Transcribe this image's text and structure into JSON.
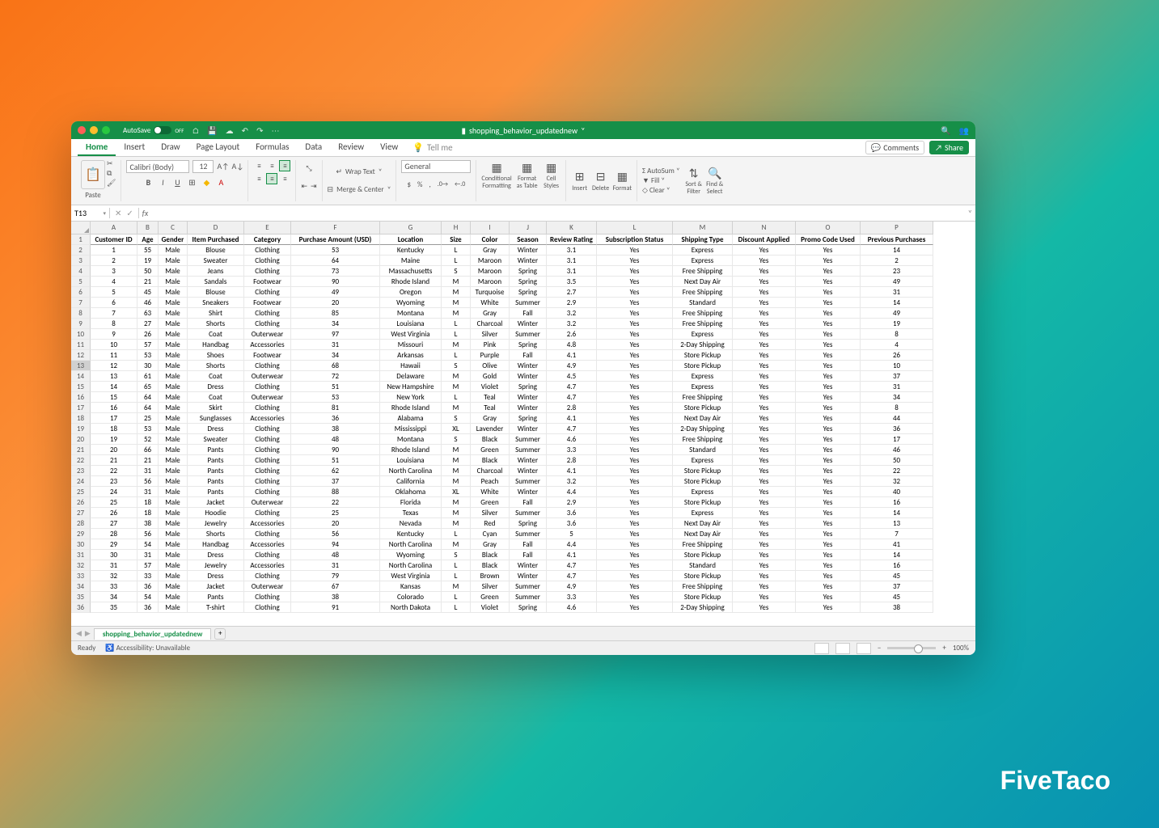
{
  "titlebar": {
    "autosave_label": "AutoSave",
    "autosave_state": "OFF",
    "filename": "shopping_behavior_updatednew"
  },
  "tabs": {
    "items": [
      "Home",
      "Insert",
      "Draw",
      "Page Layout",
      "Formulas",
      "Data",
      "Review",
      "View"
    ],
    "active": 0,
    "tellme": "Tell me",
    "comments": "Comments",
    "share": "Share"
  },
  "ribbon": {
    "paste": "Paste",
    "font_name": "Calibri (Body)",
    "font_size": "12",
    "wrap_text": "Wrap Text",
    "merge_center": "Merge & Center",
    "number_format": "General",
    "conditional": "Conditional",
    "conditional2": "Formatting",
    "format_as": "Format",
    "format_as2": "as Table",
    "cell_styles": "Cell",
    "cell_styles2": "Styles",
    "insert": "Insert",
    "delete": "Delete",
    "format": "Format",
    "autosum": "AutoSum",
    "fill": "Fill",
    "clear": "Clear",
    "sort": "Sort &",
    "sort2": "Filter",
    "find": "Find &",
    "find2": "Select"
  },
  "namebox": "T13",
  "columns": [
    "A",
    "B",
    "C",
    "D",
    "E",
    "F",
    "G",
    "H",
    "I",
    "J",
    "K",
    "L",
    "M",
    "N",
    "O",
    "P"
  ],
  "selected_row": 13,
  "headers": [
    "Customer ID",
    "Age",
    "Gender",
    "Item Purchased",
    "Category",
    "Purchase Amount (USD)",
    "Location",
    "Size",
    "Color",
    "Season",
    "Review Rating",
    "Subscription Status",
    "Shipping Type",
    "Discount Applied",
    "Promo Code Used",
    "Previous Purchases"
  ],
  "rows": [
    [
      "1",
      "55",
      "Male",
      "Blouse",
      "Clothing",
      "53",
      "Kentucky",
      "L",
      "Gray",
      "Winter",
      "3.1",
      "Yes",
      "Express",
      "Yes",
      "Yes",
      "14"
    ],
    [
      "2",
      "19",
      "Male",
      "Sweater",
      "Clothing",
      "64",
      "Maine",
      "L",
      "Maroon",
      "Winter",
      "3.1",
      "Yes",
      "Express",
      "Yes",
      "Yes",
      "2"
    ],
    [
      "3",
      "50",
      "Male",
      "Jeans",
      "Clothing",
      "73",
      "Massachusetts",
      "S",
      "Maroon",
      "Spring",
      "3.1",
      "Yes",
      "Free Shipping",
      "Yes",
      "Yes",
      "23"
    ],
    [
      "4",
      "21",
      "Male",
      "Sandals",
      "Footwear",
      "90",
      "Rhode Island",
      "M",
      "Maroon",
      "Spring",
      "3.5",
      "Yes",
      "Next Day Air",
      "Yes",
      "Yes",
      "49"
    ],
    [
      "5",
      "45",
      "Male",
      "Blouse",
      "Clothing",
      "49",
      "Oregon",
      "M",
      "Turquoise",
      "Spring",
      "2.7",
      "Yes",
      "Free Shipping",
      "Yes",
      "Yes",
      "31"
    ],
    [
      "6",
      "46",
      "Male",
      "Sneakers",
      "Footwear",
      "20",
      "Wyoming",
      "M",
      "White",
      "Summer",
      "2.9",
      "Yes",
      "Standard",
      "Yes",
      "Yes",
      "14"
    ],
    [
      "7",
      "63",
      "Male",
      "Shirt",
      "Clothing",
      "85",
      "Montana",
      "M",
      "Gray",
      "Fall",
      "3.2",
      "Yes",
      "Free Shipping",
      "Yes",
      "Yes",
      "49"
    ],
    [
      "8",
      "27",
      "Male",
      "Shorts",
      "Clothing",
      "34",
      "Louisiana",
      "L",
      "Charcoal",
      "Winter",
      "3.2",
      "Yes",
      "Free Shipping",
      "Yes",
      "Yes",
      "19"
    ],
    [
      "9",
      "26",
      "Male",
      "Coat",
      "Outerwear",
      "97",
      "West Virginia",
      "L",
      "Silver",
      "Summer",
      "2.6",
      "Yes",
      "Express",
      "Yes",
      "Yes",
      "8"
    ],
    [
      "10",
      "57",
      "Male",
      "Handbag",
      "Accessories",
      "31",
      "Missouri",
      "M",
      "Pink",
      "Spring",
      "4.8",
      "Yes",
      "2-Day Shipping",
      "Yes",
      "Yes",
      "4"
    ],
    [
      "11",
      "53",
      "Male",
      "Shoes",
      "Footwear",
      "34",
      "Arkansas",
      "L",
      "Purple",
      "Fall",
      "4.1",
      "Yes",
      "Store Pickup",
      "Yes",
      "Yes",
      "26"
    ],
    [
      "12",
      "30",
      "Male",
      "Shorts",
      "Clothing",
      "68",
      "Hawaii",
      "S",
      "Olive",
      "Winter",
      "4.9",
      "Yes",
      "Store Pickup",
      "Yes",
      "Yes",
      "10"
    ],
    [
      "13",
      "61",
      "Male",
      "Coat",
      "Outerwear",
      "72",
      "Delaware",
      "M",
      "Gold",
      "Winter",
      "4.5",
      "Yes",
      "Express",
      "Yes",
      "Yes",
      "37"
    ],
    [
      "14",
      "65",
      "Male",
      "Dress",
      "Clothing",
      "51",
      "New Hampshire",
      "M",
      "Violet",
      "Spring",
      "4.7",
      "Yes",
      "Express",
      "Yes",
      "Yes",
      "31"
    ],
    [
      "15",
      "64",
      "Male",
      "Coat",
      "Outerwear",
      "53",
      "New York",
      "L",
      "Teal",
      "Winter",
      "4.7",
      "Yes",
      "Free Shipping",
      "Yes",
      "Yes",
      "34"
    ],
    [
      "16",
      "64",
      "Male",
      "Skirt",
      "Clothing",
      "81",
      "Rhode Island",
      "M",
      "Teal",
      "Winter",
      "2.8",
      "Yes",
      "Store Pickup",
      "Yes",
      "Yes",
      "8"
    ],
    [
      "17",
      "25",
      "Male",
      "Sunglasses",
      "Accessories",
      "36",
      "Alabama",
      "S",
      "Gray",
      "Spring",
      "4.1",
      "Yes",
      "Next Day Air",
      "Yes",
      "Yes",
      "44"
    ],
    [
      "18",
      "53",
      "Male",
      "Dress",
      "Clothing",
      "38",
      "Mississippi",
      "XL",
      "Lavender",
      "Winter",
      "4.7",
      "Yes",
      "2-Day Shipping",
      "Yes",
      "Yes",
      "36"
    ],
    [
      "19",
      "52",
      "Male",
      "Sweater",
      "Clothing",
      "48",
      "Montana",
      "S",
      "Black",
      "Summer",
      "4.6",
      "Yes",
      "Free Shipping",
      "Yes",
      "Yes",
      "17"
    ],
    [
      "20",
      "66",
      "Male",
      "Pants",
      "Clothing",
      "90",
      "Rhode Island",
      "M",
      "Green",
      "Summer",
      "3.3",
      "Yes",
      "Standard",
      "Yes",
      "Yes",
      "46"
    ],
    [
      "21",
      "21",
      "Male",
      "Pants",
      "Clothing",
      "51",
      "Louisiana",
      "M",
      "Black",
      "Winter",
      "2.8",
      "Yes",
      "Express",
      "Yes",
      "Yes",
      "50"
    ],
    [
      "22",
      "31",
      "Male",
      "Pants",
      "Clothing",
      "62",
      "North Carolina",
      "M",
      "Charcoal",
      "Winter",
      "4.1",
      "Yes",
      "Store Pickup",
      "Yes",
      "Yes",
      "22"
    ],
    [
      "23",
      "56",
      "Male",
      "Pants",
      "Clothing",
      "37",
      "California",
      "M",
      "Peach",
      "Summer",
      "3.2",
      "Yes",
      "Store Pickup",
      "Yes",
      "Yes",
      "32"
    ],
    [
      "24",
      "31",
      "Male",
      "Pants",
      "Clothing",
      "88",
      "Oklahoma",
      "XL",
      "White",
      "Winter",
      "4.4",
      "Yes",
      "Express",
      "Yes",
      "Yes",
      "40"
    ],
    [
      "25",
      "18",
      "Male",
      "Jacket",
      "Outerwear",
      "22",
      "Florida",
      "M",
      "Green",
      "Fall",
      "2.9",
      "Yes",
      "Store Pickup",
      "Yes",
      "Yes",
      "16"
    ],
    [
      "26",
      "18",
      "Male",
      "Hoodie",
      "Clothing",
      "25",
      "Texas",
      "M",
      "Silver",
      "Summer",
      "3.6",
      "Yes",
      "Express",
      "Yes",
      "Yes",
      "14"
    ],
    [
      "27",
      "38",
      "Male",
      "Jewelry",
      "Accessories",
      "20",
      "Nevada",
      "M",
      "Red",
      "Spring",
      "3.6",
      "Yes",
      "Next Day Air",
      "Yes",
      "Yes",
      "13"
    ],
    [
      "28",
      "56",
      "Male",
      "Shorts",
      "Clothing",
      "56",
      "Kentucky",
      "L",
      "Cyan",
      "Summer",
      "5",
      "Yes",
      "Next Day Air",
      "Yes",
      "Yes",
      "7"
    ],
    [
      "29",
      "54",
      "Male",
      "Handbag",
      "Accessories",
      "94",
      "North Carolina",
      "M",
      "Gray",
      "Fall",
      "4.4",
      "Yes",
      "Free Shipping",
      "Yes",
      "Yes",
      "41"
    ],
    [
      "30",
      "31",
      "Male",
      "Dress",
      "Clothing",
      "48",
      "Wyoming",
      "S",
      "Black",
      "Fall",
      "4.1",
      "Yes",
      "Store Pickup",
      "Yes",
      "Yes",
      "14"
    ],
    [
      "31",
      "57",
      "Male",
      "Jewelry",
      "Accessories",
      "31",
      "North Carolina",
      "L",
      "Black",
      "Winter",
      "4.7",
      "Yes",
      "Standard",
      "Yes",
      "Yes",
      "16"
    ],
    [
      "32",
      "33",
      "Male",
      "Dress",
      "Clothing",
      "79",
      "West Virginia",
      "L",
      "Brown",
      "Winter",
      "4.7",
      "Yes",
      "Store Pickup",
      "Yes",
      "Yes",
      "45"
    ],
    [
      "33",
      "36",
      "Male",
      "Jacket",
      "Outerwear",
      "67",
      "Kansas",
      "M",
      "Silver",
      "Summer",
      "4.9",
      "Yes",
      "Free Shipping",
      "Yes",
      "Yes",
      "37"
    ],
    [
      "34",
      "54",
      "Male",
      "Pants",
      "Clothing",
      "38",
      "Colorado",
      "L",
      "Green",
      "Summer",
      "3.3",
      "Yes",
      "Store Pickup",
      "Yes",
      "Yes",
      "45"
    ],
    [
      "35",
      "36",
      "Male",
      "T-shirt",
      "Clothing",
      "91",
      "North Dakota",
      "L",
      "Violet",
      "Spring",
      "4.6",
      "Yes",
      "2-Day Shipping",
      "Yes",
      "Yes",
      "38"
    ]
  ],
  "sheet_tab": "shopping_behavior_updatednew",
  "status": {
    "ready": "Ready",
    "accessibility": "Accessibility: Unavailable",
    "zoom": "100%"
  },
  "brand": "FiveTaco"
}
